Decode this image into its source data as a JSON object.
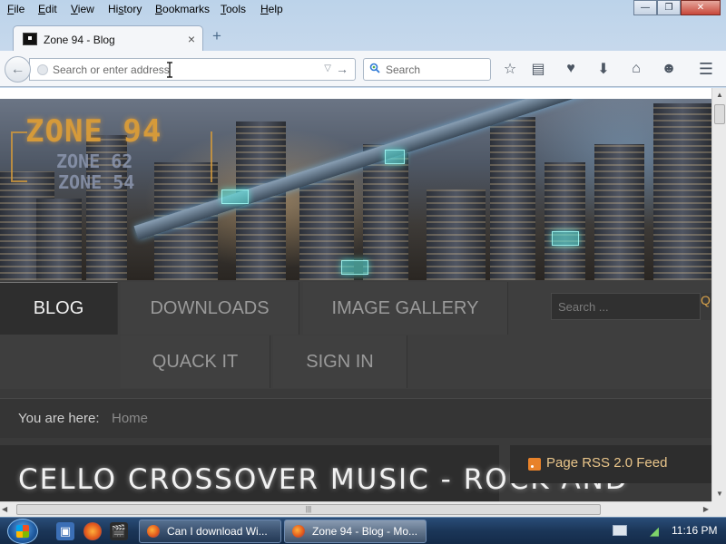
{
  "window": {
    "menu": [
      {
        "label": "File",
        "key": "F"
      },
      {
        "label": "Edit",
        "key": "E"
      },
      {
        "label": "View",
        "key": "V"
      },
      {
        "label": "History",
        "key": "s"
      },
      {
        "label": "Bookmarks",
        "key": "B"
      },
      {
        "label": "Tools",
        "key": "T"
      },
      {
        "label": "Help",
        "key": "H"
      }
    ],
    "controls": {
      "minimize": "—",
      "maximize": "❐",
      "close": "✕"
    }
  },
  "tabs": [
    {
      "title": "Zone 94 - Blog",
      "close": "×",
      "active": true
    }
  ],
  "new_tab": "+",
  "navbar": {
    "back": "←",
    "url_placeholder": "Search or enter address",
    "url_value": "",
    "url_dropdown": "▽",
    "go": "→",
    "search_placeholder": "Search",
    "search_engine_icon": "search-engine-icon",
    "toolbar_icons": [
      "bookmark-star-icon",
      "reading-list-icon",
      "pocket-icon",
      "downloads-icon",
      "home-icon",
      "chat-icon",
      "menu-icon"
    ],
    "toolbar_glyphs": [
      "☆",
      "▤",
      "♥",
      "⬇",
      "⌂",
      "☻",
      "☰"
    ]
  },
  "site": {
    "logo": {
      "main": "ZONE 94",
      "line2": "ZONE 62",
      "line3": "ZONE 54"
    },
    "nav": {
      "row1": [
        "BLOG",
        "DOWNLOADS",
        "IMAGE GALLERY"
      ],
      "row2": [
        "QUACK IT",
        "SIGN IN"
      ],
      "active": "BLOG"
    },
    "search_placeholder": "Search ...",
    "search_button": "Q",
    "breadcrumb": {
      "label": "You are here:",
      "home": "Home"
    },
    "article_title": "CELLO CROSSOVER MUSIC - ROCK AND",
    "rss_label": "Page RSS 2.0 Feed",
    "colors": {
      "accent": "#d59a3a",
      "nav_bg": "#404040",
      "page_bg": "#2d2d2d"
    }
  },
  "scrollbars": {
    "up": "▲",
    "down": "▼",
    "left": "◀",
    "right": "▶",
    "grip": "|||"
  },
  "taskbar": {
    "quick_launch": [
      "switch-windows-icon",
      "firefox-icon",
      "media-icon"
    ],
    "tasks": [
      {
        "label": "Can I download Wi...",
        "active": false
      },
      {
        "label": "Zone 94 - Blog - Mo...",
        "active": true
      }
    ],
    "clock": "11:16 PM"
  }
}
